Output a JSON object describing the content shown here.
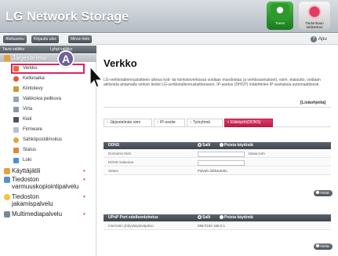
{
  "header": {
    "title": "LG Network Storage",
    "tunes_label": "Tunes",
    "help_center_label": "Tiedonhaun tukikeskus"
  },
  "toolbar": {
    "buttons": [
      "Aloitussivu",
      "Kirjaudu ulos",
      "Minun tieto"
    ],
    "help_label": "Apu"
  },
  "sidebar": {
    "tabs": [
      "Tavoi valikko",
      "Lyhyt valikko"
    ],
    "categories": [
      {
        "label": "Järjestelmä",
        "icon": "system-icon",
        "selected": true
      },
      {
        "label": "Käyttäjätili",
        "icon": "user-account-icon"
      },
      {
        "label": "Tiedoston varmuuskopiointipalvelu",
        "icon": "backup-icon"
      },
      {
        "label": "Tiedoston jakamispalvelu",
        "icon": "file-share-icon"
      },
      {
        "label": "Multimediapalvelu",
        "icon": "multimedia-icon"
      }
    ],
    "items": [
      {
        "label": "Verkko",
        "icon": "network-icon",
        "selected": true
      },
      {
        "label": "Kellonaika",
        "icon": "clock-icon"
      },
      {
        "label": "Kiintolevy",
        "icon": "hard-disk-icon"
      },
      {
        "label": "Vaikkoiva peilkuva",
        "icon": "mirror-icon"
      },
      {
        "label": "Virta",
        "icon": "power-icon"
      },
      {
        "label": "Kieli",
        "icon": "language-icon"
      },
      {
        "label": "Firmware",
        "icon": "firmware-icon"
      },
      {
        "label": "Sähköpostiilmoitus",
        "icon": "email-icon"
      },
      {
        "label": "Status",
        "icon": "status-icon"
      },
      {
        "label": "Loki",
        "icon": "log-icon"
      }
    ],
    "marker": "A"
  },
  "main": {
    "title": "Verkko",
    "description": "LG-verkkotallennuslaitteen ulkeus koti- tai toimistoverkossa voidaan muodostaa (a verkkoasetukset), esim. etaiautto, voidaan aktivoida antamalla verkon tiedot LG-verkkotallennuslaitteeseen. IP-asetus (DHCP) määrittelee IP-asetuksia automaattisesti.",
    "more_link": "[Lisäohjeita]",
    "tabs": [
      "Järjestelmän nimi",
      "IP-osoite",
      "Työryhmä",
      "Etäkäyttö(DDNS)"
    ],
    "active_tab": 3,
    "ddns": {
      "title": "DDNS",
      "allow_label": "Salli",
      "disable_label": "Poista käytöstä",
      "domain_label": "Domainin Nimi",
      "domain_suffix": ".lanas.com",
      "password_label": "DDNS salasana",
      "status_label": "Status",
      "status_value": "Palvelu lakkautettu",
      "apply_label": "Aseta"
    },
    "upnp": {
      "title": "UPnP Port edelleenlohetus",
      "allow_label": "Salli",
      "disable_label": "Poista käytöstä",
      "ip_label": "Internetin yhdyskäytäväjakso",
      "ip_value": "MM://192.168.0.1",
      "apply_label": "Aseta"
    }
  },
  "colors": {
    "accent": "#c8215a",
    "header_bg": "#c6ccd2",
    "panel_head": "#4a5159"
  }
}
